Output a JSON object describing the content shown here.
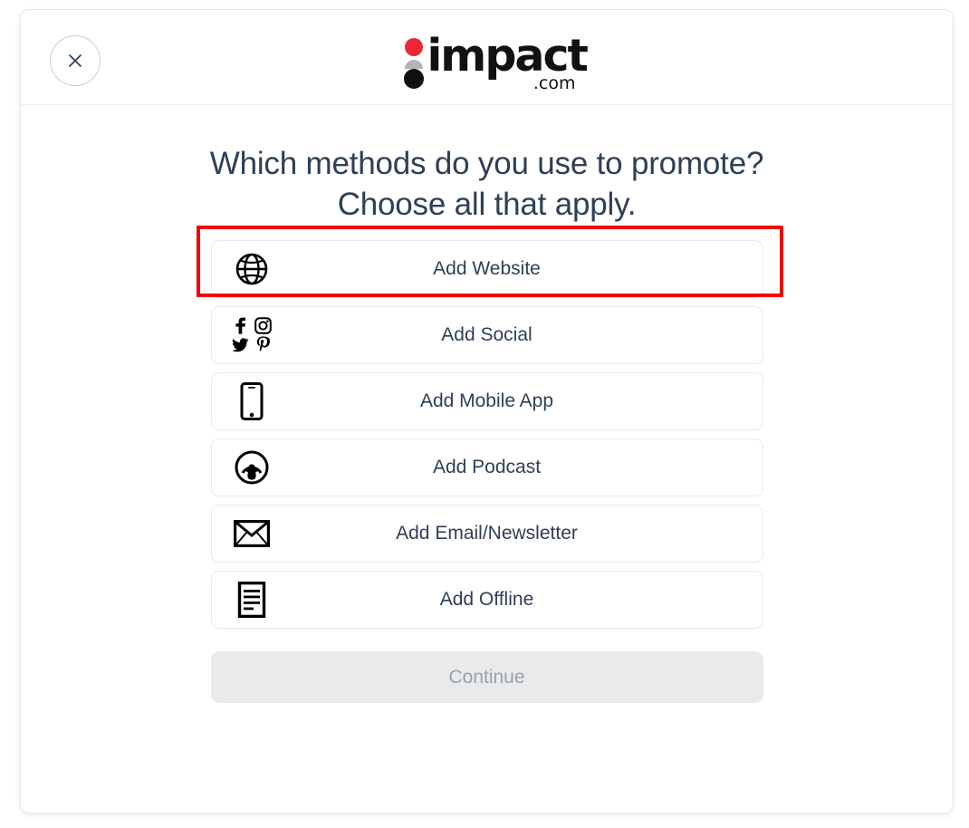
{
  "window": {
    "background_color": "#ffffff"
  },
  "card": {
    "header": {
      "close_button": {
        "icon": "close-icon",
        "label": "Close"
      },
      "logo": {
        "wordmark": "impact",
        "suffix": ".com",
        "dot_colors": [
          "#ee2737",
          "#b0b3b8",
          "#111111"
        ]
      }
    },
    "headline": "Which methods do you use to promote? Choose all that apply.",
    "options": [
      {
        "id": "website",
        "label": "Add Website",
        "icon": "globe-icon"
      },
      {
        "id": "social",
        "label": "Add Social",
        "icon": "social-icons-grid"
      },
      {
        "id": "mobile",
        "label": "Add Mobile App",
        "icon": "mobile-phone-icon"
      },
      {
        "id": "podcast",
        "label": "Add Podcast",
        "icon": "podcast-icon"
      },
      {
        "id": "email",
        "label": "Add Email/Newsletter",
        "icon": "envelope-icon"
      },
      {
        "id": "offline",
        "label": "Add Offline",
        "icon": "document-icon"
      }
    ],
    "continue": {
      "label": "Continue",
      "disabled": true,
      "background_color": "#e9eaec",
      "text_color": "#9ba1a9"
    }
  },
  "annotation": {
    "highlight_target": "Add Website",
    "color": "#f40000"
  },
  "colors": {
    "heading_text": "#2e4057",
    "option_border": "#e9eaec",
    "card_border": "#e6e7e9",
    "brand_red": "#ee2737"
  }
}
